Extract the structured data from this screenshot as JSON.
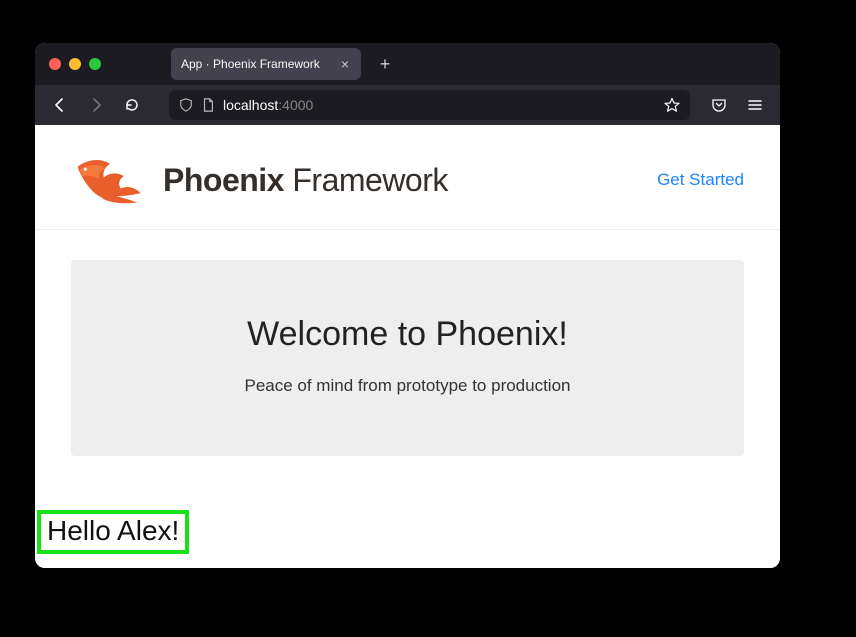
{
  "browser": {
    "tab_title": "App · Phoenix Framework",
    "url_host": "localhost",
    "url_port": ":4000"
  },
  "header": {
    "brand_bold": "Phoenix",
    "brand_light": " Framework",
    "get_started": "Get Started"
  },
  "hero": {
    "title": "Welcome to Phoenix!",
    "subtitle": "Peace of mind from prototype to production"
  },
  "highlight": {
    "text": "Hello Alex!"
  }
}
